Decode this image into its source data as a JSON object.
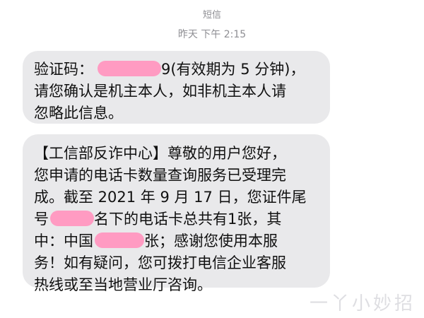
{
  "header": {
    "service_label": "短信",
    "timestamp": "昨天 下午 2:15"
  },
  "messages": [
    {
      "lines": [
        {
          "before": "验证码：",
          "redacted": true,
          "after": "9(有效期为 5 分钟)，"
        },
        {
          "text": "请您确认是机主本人，如非机主本人请"
        },
        {
          "text": "忽略此信息。"
        }
      ]
    },
    {
      "lines": [
        {
          "text": "【工信部反诈中心】尊敬的用户您好，"
        },
        {
          "text": "您申请的电话卡数量查询服务已受理完"
        },
        {
          "text": "成。截至 2021 年 9 月 17 日，您证件尾"
        },
        {
          "before": "号",
          "redacted": true,
          "after": "名下的电话卡总共有1张，其"
        },
        {
          "before": "中：中国",
          "redacted": true,
          "after": "张；感谢您使用本服"
        },
        {
          "text": "务！如有疑问，您可拨打电信企业客服"
        },
        {
          "text": "热线或至当地营业厅咨询。"
        }
      ]
    }
  ],
  "watermark": {
    "text": "一丫小妙招"
  },
  "colors": {
    "bubble_background": "#e9e9eb",
    "redaction_mark": "#ff9bc2",
    "meta_text": "#8e8e93"
  }
}
